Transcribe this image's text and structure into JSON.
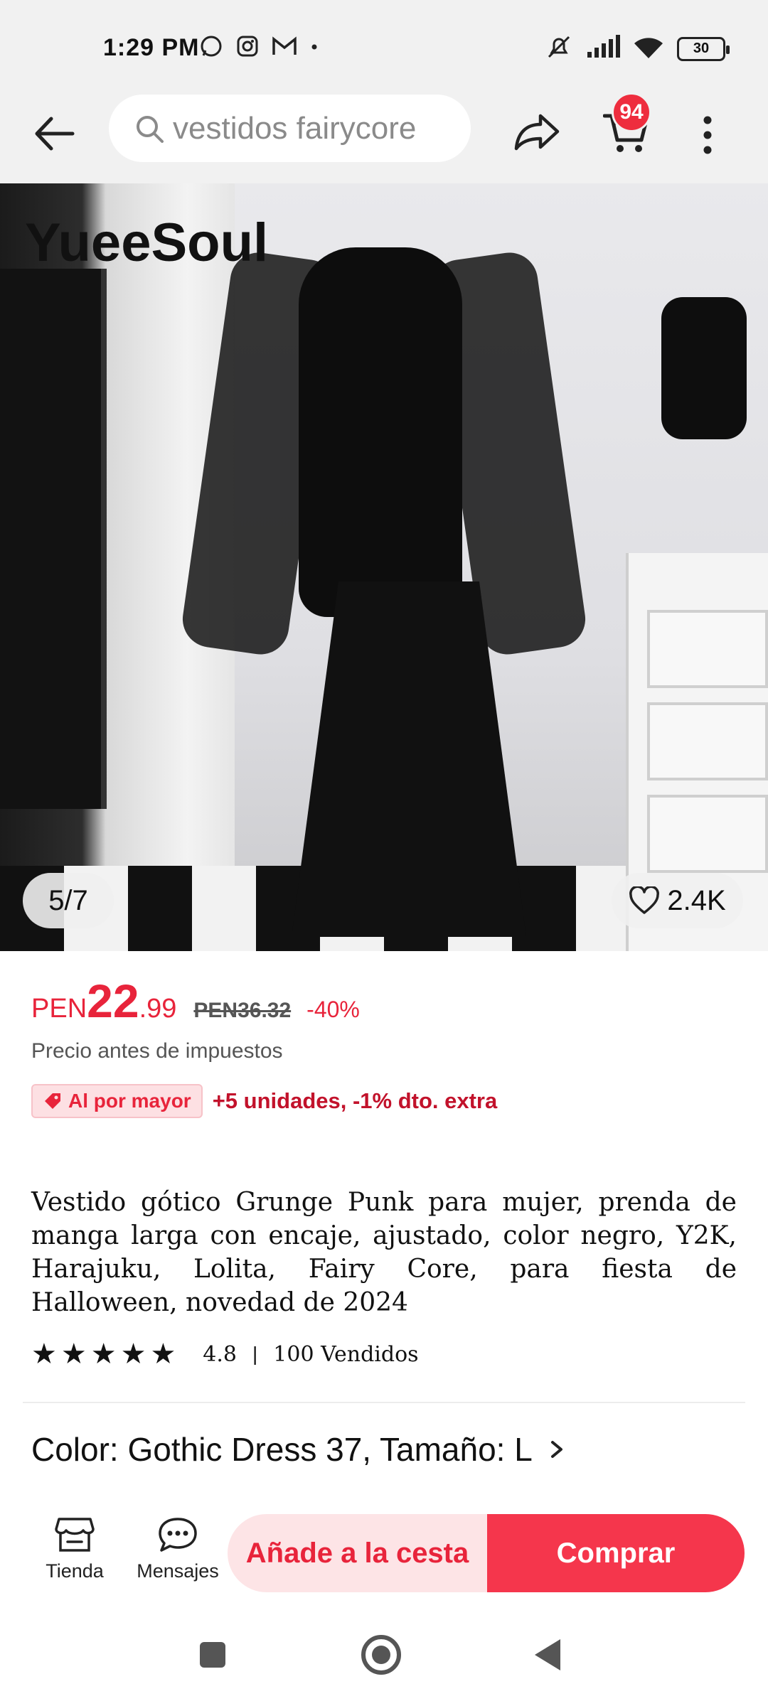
{
  "status_bar": {
    "time": "1:29 PM",
    "battery": "30",
    "icons": [
      "whatsapp-icon",
      "instagram-icon",
      "gmail-icon",
      "dot-icon",
      "mute-icon",
      "signal-icon",
      "wifi-icon",
      "battery-icon"
    ]
  },
  "header": {
    "search_placeholder": "vestidos fairycore",
    "cart_count": "94"
  },
  "gallery": {
    "brand": "YueeSoul",
    "counter": "5/7",
    "likes": "2.4K"
  },
  "price": {
    "currency": "PEN",
    "integer": "22",
    "decimal": ".99",
    "original": "PEN36.32",
    "discount": "-40%",
    "note": "Precio antes de impuestos"
  },
  "wholesale": {
    "badge": "Al por mayor",
    "text": "+5 unidades, -1% dto. extra"
  },
  "product": {
    "title": "Vestido gótico Grunge Punk para mujer, prenda de manga larga con encaje, ajustado, color negro, Y2K, Harajuku, Lolita, Fairy Core, para fiesta de Halloween, novedad de 2024",
    "rating": "4.8",
    "stars": 5,
    "sold": "100 Vendidos",
    "variant": "Color: Gothic Dress 37, Tamaño: L"
  },
  "bottom_bar": {
    "store_label": "Tienda",
    "messages_label": "Mensajes",
    "add_to_cart": "Añade a la cesta",
    "buy": "Comprar"
  },
  "colors": {
    "accent_red": "#e8243b",
    "buy_button": "#f5364c",
    "cart_button_bg": "#fde4e6",
    "header_bg": "#f1f1f1"
  }
}
